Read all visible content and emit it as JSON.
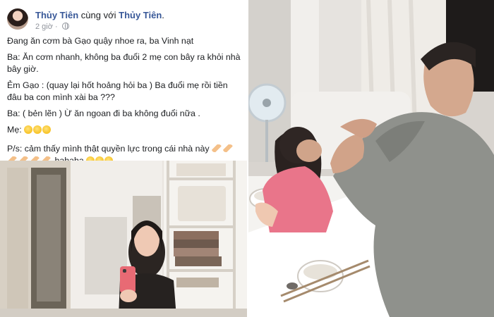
{
  "post": {
    "author": "Thủy Tiên",
    "with_text": "cùng với",
    "tagged": "Thủy Tiên",
    "tagged_suffix": ".",
    "time": "2 giờ",
    "separator": "·",
    "lines": [
      "Đang ăn cơm bà Gạo quậy nhoe ra, ba Vinh nạt",
      "Ba: Ăn cơm nhanh, không ba đuổi 2 mẹ con bây ra khỏi nhà bây giờ.",
      "Ẻm Gạo : (quay lại hốt hoảng hỏi ba ) Ba đuổi mẹ rồi tiền đâu ba con mình xài ba ???",
      "Ba: ( bẻn lẽn ) Ừ ăn ngoan đi ba không đuổi nữa .",
      "Mẹ:"
    ],
    "ps_text": "P/s: cảm thấy mình thật quyền lực trong cái nhà này",
    "ps_tail": "hahaha"
  },
  "icons": {
    "avatar": "avatar",
    "globe": "globe-icon",
    "emoji_face": "grinning-sweat-emoji",
    "emoji_arm": "flexed-biceps-emoji",
    "emoji_laugh": "rolling-laughing-emoji"
  },
  "colors": {
    "author_link": "#385898",
    "meta_gray": "#90949c",
    "text": "#1c1e21",
    "shirt": "#8d8f8a"
  }
}
